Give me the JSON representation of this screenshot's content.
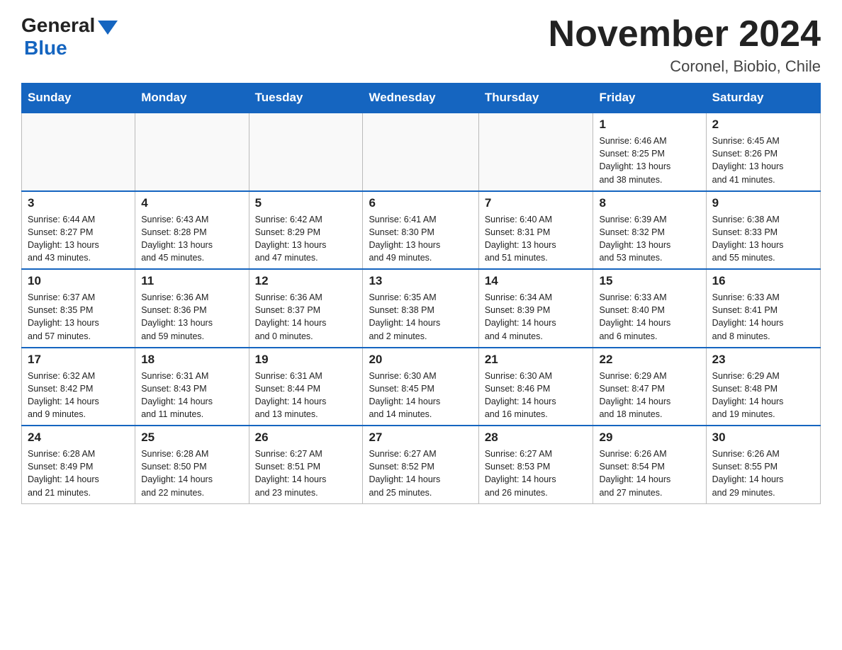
{
  "header": {
    "logo_general": "General",
    "logo_blue": "Blue",
    "month_title": "November 2024",
    "location": "Coronel, Biobio, Chile"
  },
  "days_of_week": [
    "Sunday",
    "Monday",
    "Tuesday",
    "Wednesday",
    "Thursday",
    "Friday",
    "Saturday"
  ],
  "weeks": [
    [
      {
        "day": "",
        "info": ""
      },
      {
        "day": "",
        "info": ""
      },
      {
        "day": "",
        "info": ""
      },
      {
        "day": "",
        "info": ""
      },
      {
        "day": "",
        "info": ""
      },
      {
        "day": "1",
        "info": "Sunrise: 6:46 AM\nSunset: 8:25 PM\nDaylight: 13 hours\nand 38 minutes."
      },
      {
        "day": "2",
        "info": "Sunrise: 6:45 AM\nSunset: 8:26 PM\nDaylight: 13 hours\nand 41 minutes."
      }
    ],
    [
      {
        "day": "3",
        "info": "Sunrise: 6:44 AM\nSunset: 8:27 PM\nDaylight: 13 hours\nand 43 minutes."
      },
      {
        "day": "4",
        "info": "Sunrise: 6:43 AM\nSunset: 8:28 PM\nDaylight: 13 hours\nand 45 minutes."
      },
      {
        "day": "5",
        "info": "Sunrise: 6:42 AM\nSunset: 8:29 PM\nDaylight: 13 hours\nand 47 minutes."
      },
      {
        "day": "6",
        "info": "Sunrise: 6:41 AM\nSunset: 8:30 PM\nDaylight: 13 hours\nand 49 minutes."
      },
      {
        "day": "7",
        "info": "Sunrise: 6:40 AM\nSunset: 8:31 PM\nDaylight: 13 hours\nand 51 minutes."
      },
      {
        "day": "8",
        "info": "Sunrise: 6:39 AM\nSunset: 8:32 PM\nDaylight: 13 hours\nand 53 minutes."
      },
      {
        "day": "9",
        "info": "Sunrise: 6:38 AM\nSunset: 8:33 PM\nDaylight: 13 hours\nand 55 minutes."
      }
    ],
    [
      {
        "day": "10",
        "info": "Sunrise: 6:37 AM\nSunset: 8:35 PM\nDaylight: 13 hours\nand 57 minutes."
      },
      {
        "day": "11",
        "info": "Sunrise: 6:36 AM\nSunset: 8:36 PM\nDaylight: 13 hours\nand 59 minutes."
      },
      {
        "day": "12",
        "info": "Sunrise: 6:36 AM\nSunset: 8:37 PM\nDaylight: 14 hours\nand 0 minutes."
      },
      {
        "day": "13",
        "info": "Sunrise: 6:35 AM\nSunset: 8:38 PM\nDaylight: 14 hours\nand 2 minutes."
      },
      {
        "day": "14",
        "info": "Sunrise: 6:34 AM\nSunset: 8:39 PM\nDaylight: 14 hours\nand 4 minutes."
      },
      {
        "day": "15",
        "info": "Sunrise: 6:33 AM\nSunset: 8:40 PM\nDaylight: 14 hours\nand 6 minutes."
      },
      {
        "day": "16",
        "info": "Sunrise: 6:33 AM\nSunset: 8:41 PM\nDaylight: 14 hours\nand 8 minutes."
      }
    ],
    [
      {
        "day": "17",
        "info": "Sunrise: 6:32 AM\nSunset: 8:42 PM\nDaylight: 14 hours\nand 9 minutes."
      },
      {
        "day": "18",
        "info": "Sunrise: 6:31 AM\nSunset: 8:43 PM\nDaylight: 14 hours\nand 11 minutes."
      },
      {
        "day": "19",
        "info": "Sunrise: 6:31 AM\nSunset: 8:44 PM\nDaylight: 14 hours\nand 13 minutes."
      },
      {
        "day": "20",
        "info": "Sunrise: 6:30 AM\nSunset: 8:45 PM\nDaylight: 14 hours\nand 14 minutes."
      },
      {
        "day": "21",
        "info": "Sunrise: 6:30 AM\nSunset: 8:46 PM\nDaylight: 14 hours\nand 16 minutes."
      },
      {
        "day": "22",
        "info": "Sunrise: 6:29 AM\nSunset: 8:47 PM\nDaylight: 14 hours\nand 18 minutes."
      },
      {
        "day": "23",
        "info": "Sunrise: 6:29 AM\nSunset: 8:48 PM\nDaylight: 14 hours\nand 19 minutes."
      }
    ],
    [
      {
        "day": "24",
        "info": "Sunrise: 6:28 AM\nSunset: 8:49 PM\nDaylight: 14 hours\nand 21 minutes."
      },
      {
        "day": "25",
        "info": "Sunrise: 6:28 AM\nSunset: 8:50 PM\nDaylight: 14 hours\nand 22 minutes."
      },
      {
        "day": "26",
        "info": "Sunrise: 6:27 AM\nSunset: 8:51 PM\nDaylight: 14 hours\nand 23 minutes."
      },
      {
        "day": "27",
        "info": "Sunrise: 6:27 AM\nSunset: 8:52 PM\nDaylight: 14 hours\nand 25 minutes."
      },
      {
        "day": "28",
        "info": "Sunrise: 6:27 AM\nSunset: 8:53 PM\nDaylight: 14 hours\nand 26 minutes."
      },
      {
        "day": "29",
        "info": "Sunrise: 6:26 AM\nSunset: 8:54 PM\nDaylight: 14 hours\nand 27 minutes."
      },
      {
        "day": "30",
        "info": "Sunrise: 6:26 AM\nSunset: 8:55 PM\nDaylight: 14 hours\nand 29 minutes."
      }
    ]
  ]
}
